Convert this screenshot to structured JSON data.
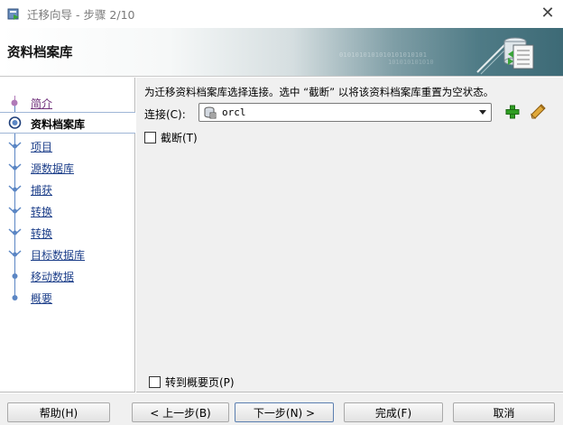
{
  "window": {
    "title": "迁移向导 - 步骤 2/10",
    "close_glyph": "✕"
  },
  "banner": {
    "title": "资料档案库",
    "binary_text": "0101010101010101010101",
    "binary_text2": "101010101010"
  },
  "nav": {
    "items": [
      {
        "label": "简介",
        "state": "visited"
      },
      {
        "label": "资料档案库",
        "state": "current"
      },
      {
        "label": "项目",
        "state": "pending"
      },
      {
        "label": "源数据库",
        "state": "pending"
      },
      {
        "label": "捕获 ",
        "state": "pending"
      },
      {
        "label": "转换",
        "state": "pending"
      },
      {
        "label": "转换",
        "state": "pending"
      },
      {
        "label": "目标数据库",
        "state": "pending"
      },
      {
        "label": "移动数据",
        "state": "pending"
      },
      {
        "label": "概要",
        "state": "pending"
      }
    ]
  },
  "main": {
    "instruction": "为迁移资料档案库选择连接。选中 “截断” 以将该资料档案库重置为空状态。",
    "connection_label": "连接(C):",
    "connection_value": "orcl",
    "truncate_label": "截断(T)",
    "truncate_checked": false,
    "goto_summary_label": "转到概要页(P)",
    "goto_summary_checked": false
  },
  "buttons": {
    "help": "帮助(H)",
    "back": "< 上一步(B)",
    "next": "下一步(N) >",
    "finish": "完成(F)",
    "cancel": "取消"
  },
  "icons": {
    "app": "wizard-app-icon",
    "add": "green-plus-icon",
    "edit": "pencil-icon",
    "db": "database-icon",
    "dropdown": "chevron-down-icon"
  },
  "colors": {
    "link": "#1d3f8a",
    "visited_link": "#6d2c78",
    "rail": "#5b86c4",
    "add_green": "#2f9e22"
  }
}
